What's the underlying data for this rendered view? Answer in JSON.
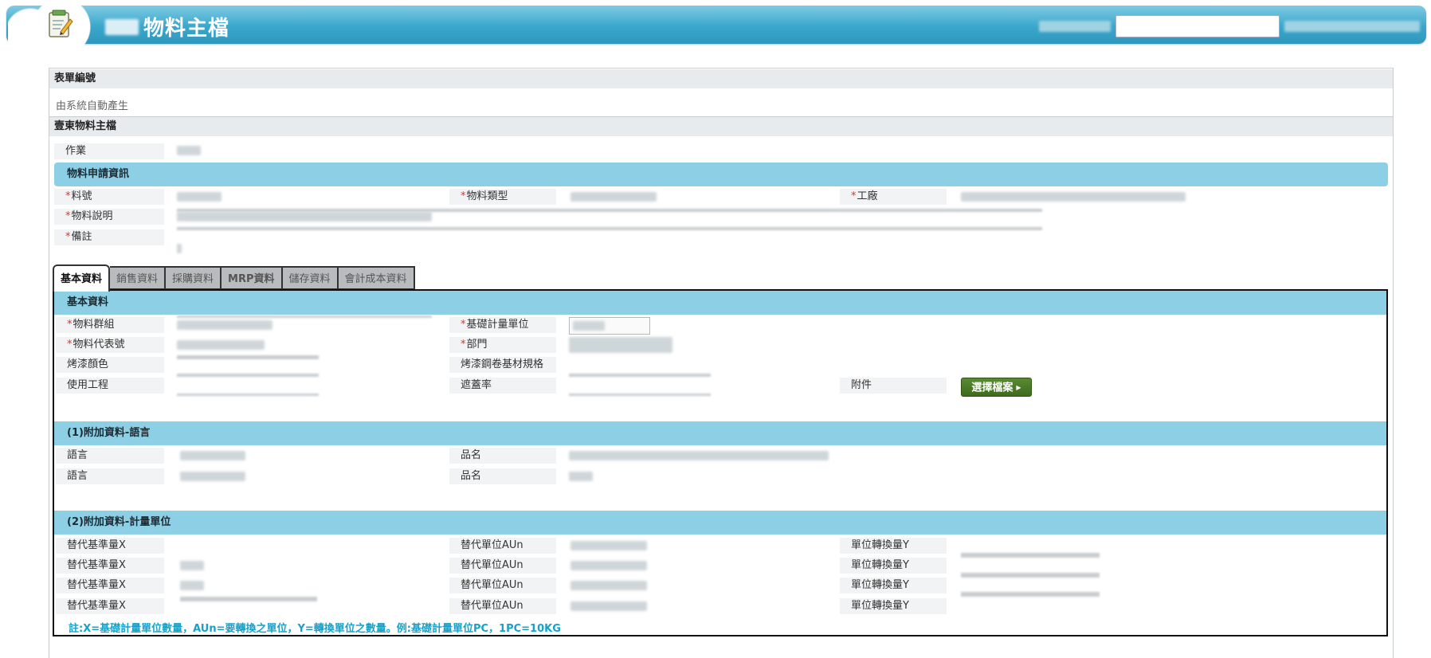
{
  "header": {
    "title": "物料主檔",
    "search": {
      "value": "",
      "placeholder": ""
    }
  },
  "form": {
    "form_number_label": "表單編號",
    "auto_generated_text": "由系統自動產生",
    "master_section": "壹東物料主檔",
    "operation_label": "作業",
    "application_section": "物料申請資訊",
    "material_no_label": "料號",
    "material_type_label": "物料類型",
    "plant_label": "工廠",
    "material_desc_label": "物料說明",
    "remark_label": "備註"
  },
  "tabs": [
    {
      "label": "基本資料",
      "active": true
    },
    {
      "label": "銷售資料",
      "active": false
    },
    {
      "label": "採購資料",
      "active": false
    },
    {
      "label": "MRP資料",
      "active": false
    },
    {
      "label": "儲存資料",
      "active": false
    },
    {
      "label": "會計成本資料",
      "active": false
    }
  ],
  "basic": {
    "section_title": "基本資料",
    "material_group_label": "物料群組",
    "base_unit_label": "基礎計量單位",
    "material_rep_no_label": "物料代表號",
    "department_label": "部門",
    "paint_color_label": "烤漆顏色",
    "paint_steel_spec_label": "烤漆鋼卷基材規格",
    "usage_project_label": "使用工程",
    "coverage_label": "遮蓋率",
    "attachment_label": "附件",
    "choose_file_button": "選擇檔案"
  },
  "lang_section": {
    "title": "(1)附加資料-語言",
    "rows": [
      {
        "lang_label": "語言",
        "name_label": "品名"
      },
      {
        "lang_label": "語言",
        "name_label": "品名"
      }
    ]
  },
  "unit_section": {
    "title": "(2)附加資料-計量單位",
    "rows": [
      {
        "x_label": "替代基準量X",
        "aun_label": "替代單位AUn",
        "y_label": "單位轉換量Y"
      },
      {
        "x_label": "替代基準量X",
        "aun_label": "替代單位AUn",
        "y_label": "單位轉換量Y"
      },
      {
        "x_label": "替代基準量X",
        "aun_label": "替代單位AUn",
        "y_label": "單位轉換量Y"
      },
      {
        "x_label": "替代基準量X",
        "aun_label": "替代單位AUn",
        "y_label": "單位轉換量Y"
      }
    ],
    "note": "註:X=基礎計量單位數量，AUn=要轉換之單位，Y=轉換單位之數量。例:基礎計量單位PC，1PC=10KG"
  },
  "required_mark": "*"
}
